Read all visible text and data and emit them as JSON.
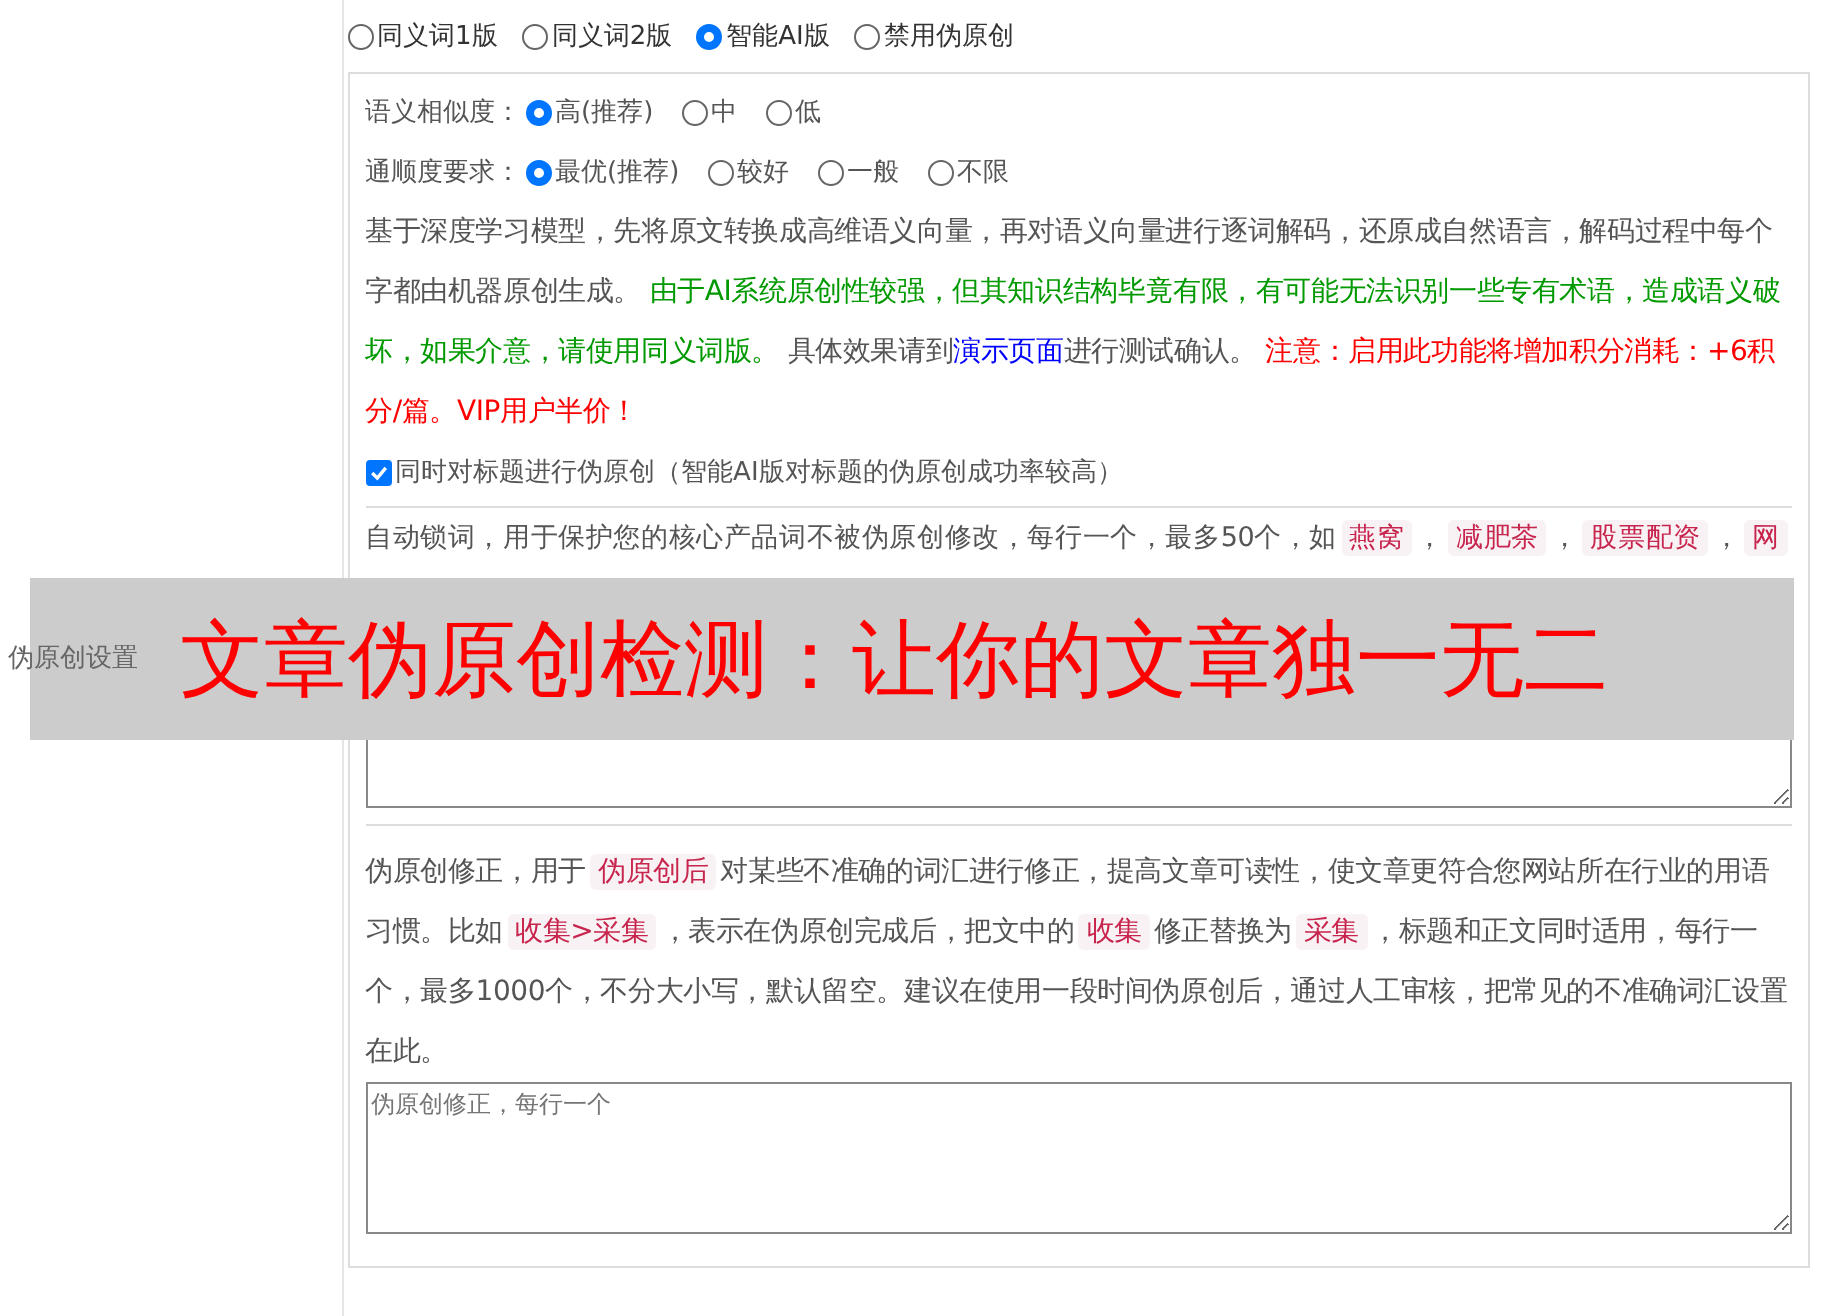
{
  "side_label": "伪原创设置",
  "modes": [
    {
      "label": "同义词1版",
      "selected": false
    },
    {
      "label": "同义词2版",
      "selected": false
    },
    {
      "label": "智能AI版",
      "selected": true
    },
    {
      "label": "禁用伪原创",
      "selected": false
    }
  ],
  "settings": [
    {
      "label": "语义相似度：",
      "options": [
        {
          "label": "高(推荐)",
          "selected": true
        },
        {
          "label": "中",
          "selected": false
        },
        {
          "label": "低",
          "selected": false
        }
      ]
    },
    {
      "label": "通顺度要求：",
      "options": [
        {
          "label": "最优(推荐)",
          "selected": true
        },
        {
          "label": "较好",
          "selected": false
        },
        {
          "label": "一般",
          "selected": false
        },
        {
          "label": "不限",
          "selected": false
        }
      ]
    }
  ],
  "description": [
    {
      "kind": "text",
      "text": "基于深度学习模型，先将原文转换成高维语义向量，再对语义向量进行逐词解码，还原成自然语言，解码过程中每个字都由机器原创生成。 "
    },
    {
      "kind": "green",
      "text": "由于AI系统原创性较强，但其知识结构毕竟有限，有可能无法识别一些专有术语，造成语义破坏，如果介意，请使用同义词版。"
    },
    {
      "kind": "text",
      "text": " 具体效果请到"
    },
    {
      "kind": "link",
      "text": "演示页面"
    },
    {
      "kind": "text",
      "text": "进行测试确认。 "
    },
    {
      "kind": "red",
      "text": "注意：启用此功能将增加积分消耗：+6积分/篇。VIP用户半价！"
    }
  ],
  "title_option": {
    "label": "同时对标题进行伪原创（智能AI版对标题的伪原创成功率较高）",
    "checked": true
  },
  "auto_lock": [
    {
      "kind": "text",
      "text": "自动锁词，用于保护您的核心产品词不被伪原创修改，每行一个，最多50个，如"
    },
    {
      "kind": "tag",
      "text": "燕窝"
    },
    {
      "kind": "text",
      "text": "，"
    },
    {
      "kind": "tag",
      "text": "减肥茶"
    },
    {
      "kind": "text",
      "text": "，"
    },
    {
      "kind": "tag",
      "text": "股票配资"
    },
    {
      "kind": "text",
      "text": "，"
    },
    {
      "kind": "tag",
      "text": "网"
    }
  ],
  "correction": {
    "help": [
      {
        "kind": "text",
        "text": "伪原创修正，用于"
      },
      {
        "kind": "tag",
        "text": "伪原创后"
      },
      {
        "kind": "text",
        "text": "对某些不准确的词汇进行修正，提高文章可读性，使文章更符合您网站所在行业的用语习惯。比如"
      },
      {
        "kind": "tag",
        "text": "收集>采集"
      },
      {
        "kind": "text",
        "text": "，表示在伪原创完成后，把文中的"
      },
      {
        "kind": "tag",
        "text": "收集"
      },
      {
        "kind": "text",
        "text": "修正替换为"
      },
      {
        "kind": "tag",
        "text": "采集"
      },
      {
        "kind": "text",
        "text": "，标题和正文同时适用，每行一个，最多1000个，不分大小写，默认留空。建议在使用一段时间伪原创后，通过人工审核，把常见的不准确词汇设置在此。"
      }
    ],
    "placeholder": "伪原创修正，每行一个"
  },
  "banner": "文章伪原创检测：让你的文章独一无二"
}
